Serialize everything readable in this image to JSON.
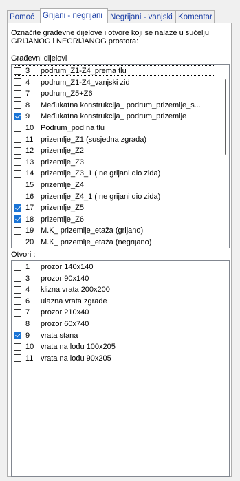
{
  "tabs": [
    {
      "label": "Pomoć"
    },
    {
      "label": "Grijani - negrijani"
    },
    {
      "label": "Negrijani - vanjski"
    },
    {
      "label": "Komentar"
    }
  ],
  "description": {
    "line1": "Označite građevne dijelove i otvore koji se nalaze u sučelju",
    "line2": "GRIJANOG i NEGRIJANOG prostora:"
  },
  "elements_group": {
    "label": "Građevni dijelovi",
    "items": [
      {
        "num": "3",
        "label": "podrum_Z1-Z4_prema tlu",
        "checked": false
      },
      {
        "num": "4",
        "label": "podrum_Z1-Z4_vanjski zid",
        "checked": false
      },
      {
        "num": "7",
        "label": "podrum_Z5+Z6",
        "checked": false
      },
      {
        "num": "8",
        "label": "Međukatna konstrukcija_ podrum_prizemlje_s...",
        "checked": false
      },
      {
        "num": "9",
        "label": "Međukatna konstrukcija_ podrum_prizemlje",
        "checked": true
      },
      {
        "num": "10",
        "label": "Podrum_pod na tlu",
        "checked": false
      },
      {
        "num": "11",
        "label": "prizemlje_Z1 (susjedna zgrada)",
        "checked": false
      },
      {
        "num": "12",
        "label": "prizemlje_Z2",
        "checked": false
      },
      {
        "num": "13",
        "label": "prizemlje_Z3",
        "checked": false
      },
      {
        "num": "14",
        "label": "prizemlje_Z3_1 ( ne grijani dio zida)",
        "checked": false
      },
      {
        "num": "15",
        "label": "prizemlje_Z4",
        "checked": false
      },
      {
        "num": "16",
        "label": "prizemlje_Z4_1 ( ne grijani dio zida)",
        "checked": false
      },
      {
        "num": "17",
        "label": "prizemlje_Z5",
        "checked": true
      },
      {
        "num": "18",
        "label": "prizemlje_Z6",
        "checked": true
      },
      {
        "num": "19",
        "label": "M.K_ prizemlje_etaža (grijano)",
        "checked": false
      },
      {
        "num": "20",
        "label": "M.K_ prizemlje_etaža (negrijano)",
        "checked": false
      }
    ]
  },
  "openings_group": {
    "label": "Otvori :",
    "items": [
      {
        "num": "1",
        "label": "prozor 140x140",
        "checked": false
      },
      {
        "num": "3",
        "label": "prozor 90x140",
        "checked": false
      },
      {
        "num": "4",
        "label": "klizna vrata 200x200",
        "checked": false
      },
      {
        "num": "6",
        "label": "ulazna vrata zgrade",
        "checked": false
      },
      {
        "num": "7",
        "label": "prozor 210x40",
        "checked": false
      },
      {
        "num": "8",
        "label": "prozor 60x740",
        "checked": false
      },
      {
        "num": "9",
        "label": "vrata stana",
        "checked": true
      },
      {
        "num": "10",
        "label": "vrata na lođu 100x205",
        "checked": false
      },
      {
        "num": "11",
        "label": "vrata na lođu 90x205",
        "checked": false
      }
    ]
  },
  "colors": {
    "accent": "#1a74d6",
    "tab_text": "#1a3ea5"
  }
}
